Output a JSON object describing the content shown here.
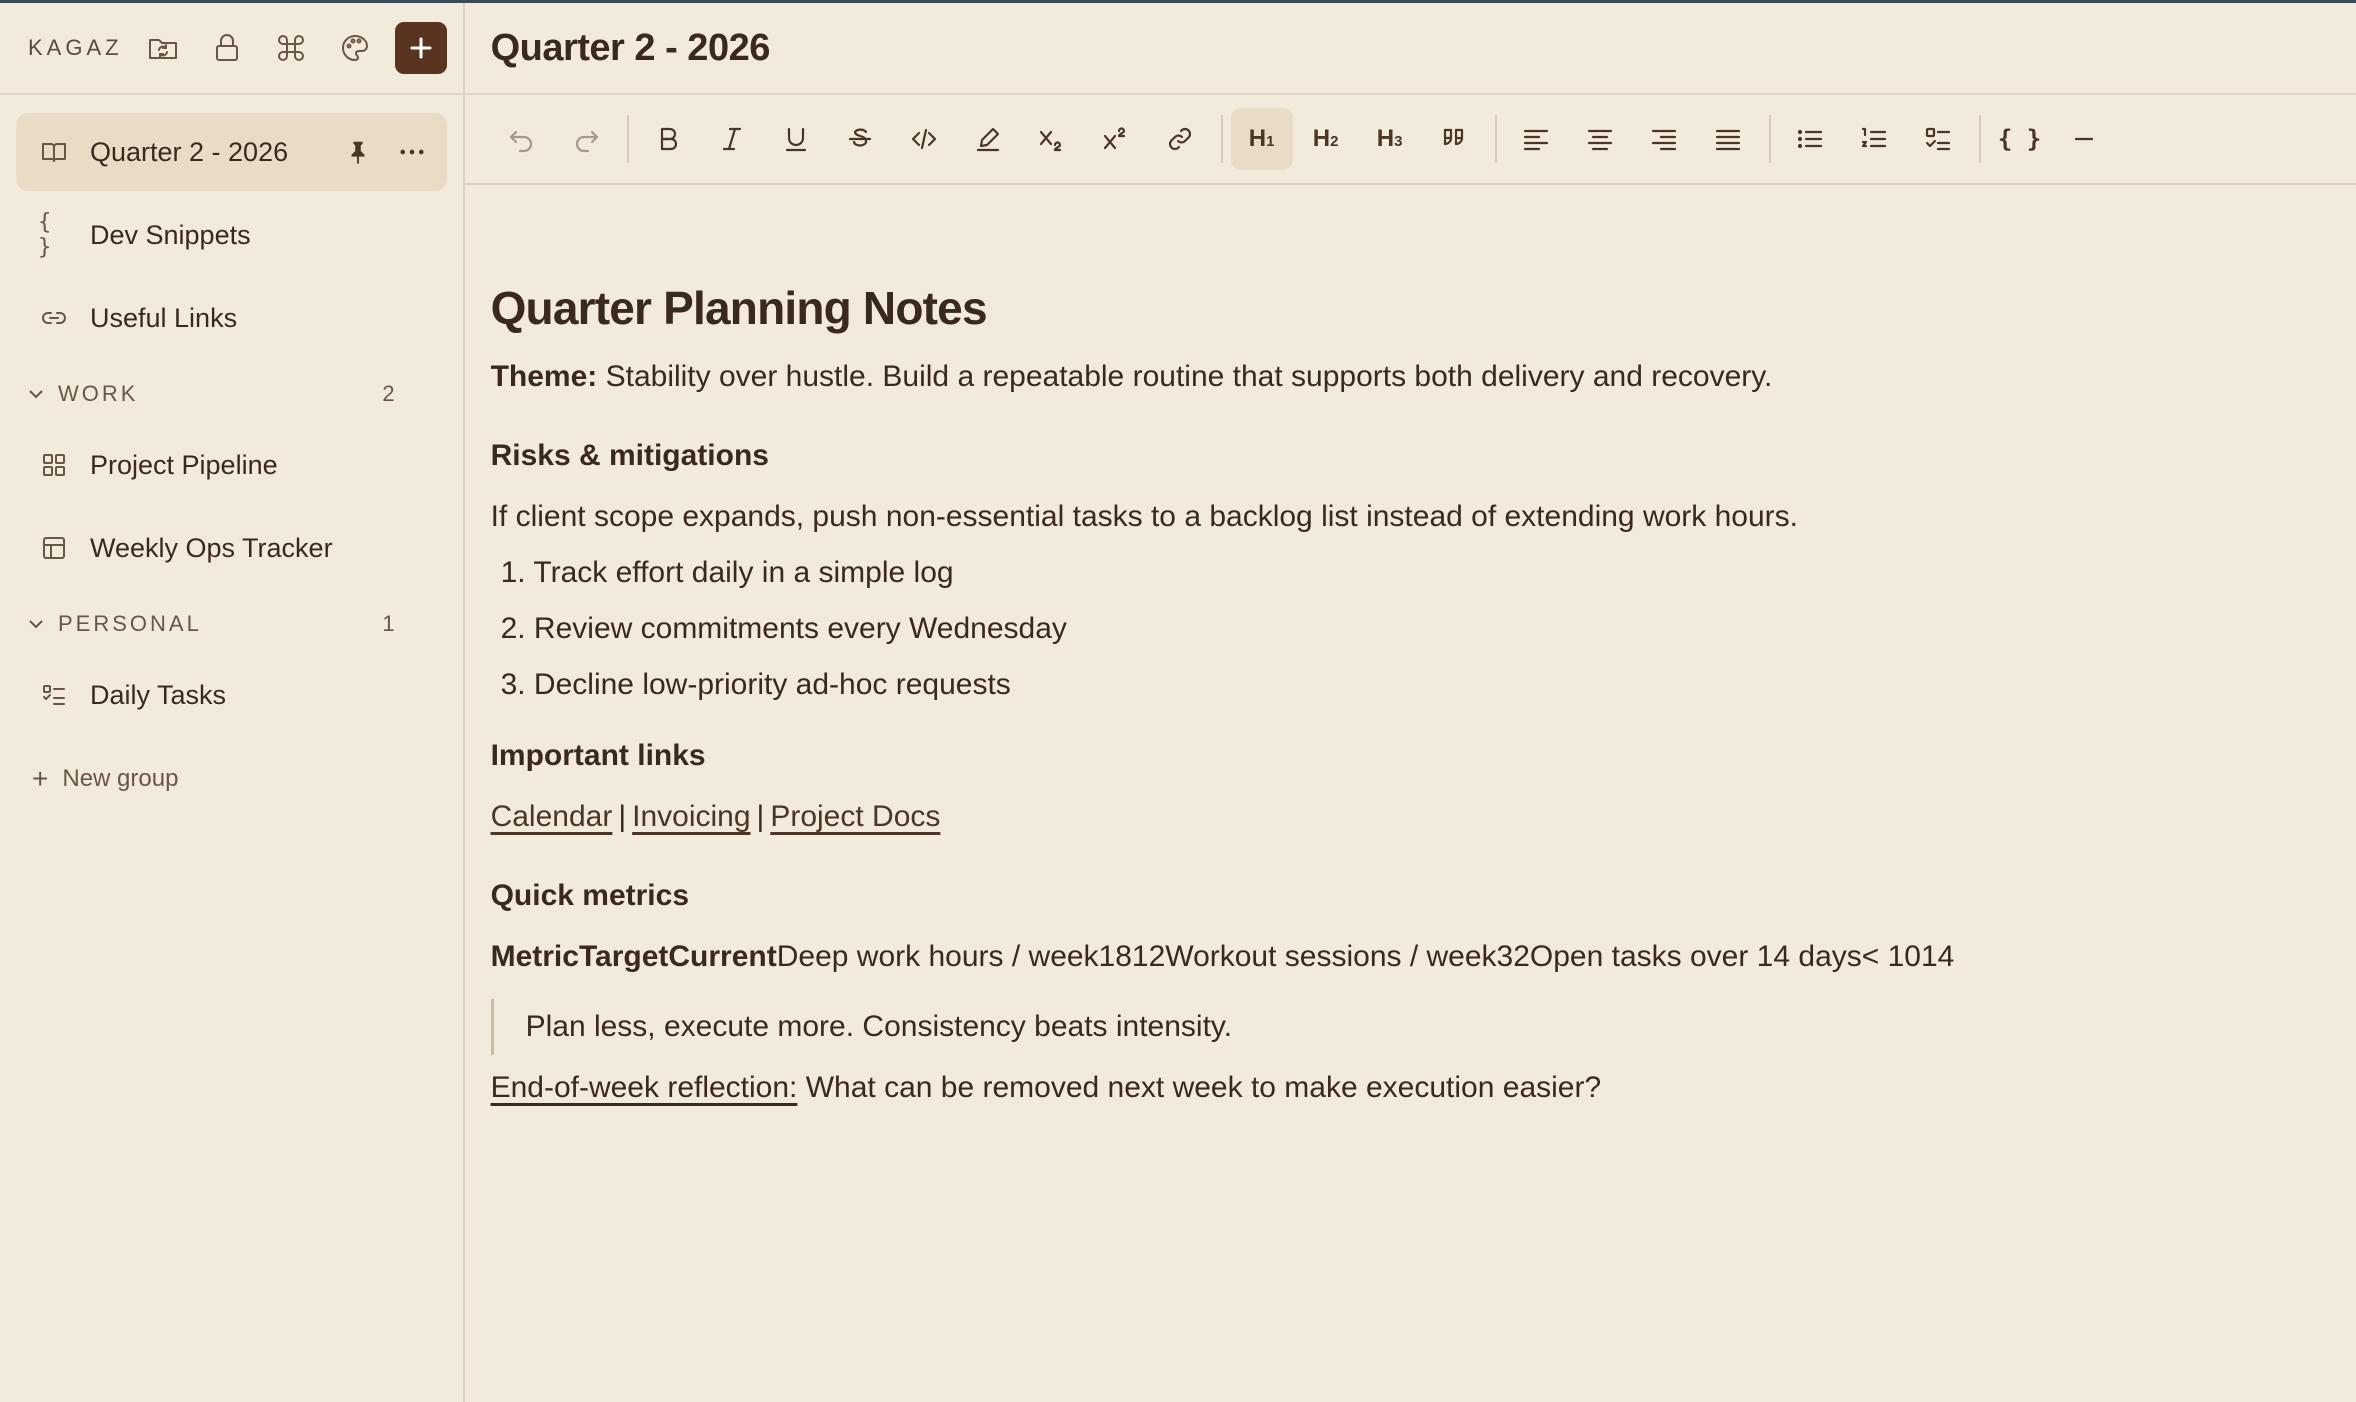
{
  "sidebar": {
    "brand": "KAGAZ",
    "header_icons": [
      "folder-sync-icon",
      "lock-icon",
      "command-icon",
      "palette-icon",
      "plus-icon"
    ],
    "pages": [
      {
        "label": "Quarter 2 - 2026",
        "icon": "book-open-icon",
        "active": true
      },
      {
        "label": "Dev Snippets",
        "icon": "braces-icon"
      },
      {
        "label": "Useful Links",
        "icon": "link-icon"
      }
    ],
    "groups": [
      {
        "name": "WORK",
        "count": "2",
        "items": [
          {
            "label": "Project Pipeline",
            "icon": "grid-icon"
          },
          {
            "label": "Weekly Ops Tracker",
            "icon": "table-icon"
          }
        ]
      },
      {
        "name": "PERSONAL",
        "count": "1",
        "items": [
          {
            "label": "Daily Tasks",
            "icon": "checklist-icon"
          }
        ]
      }
    ],
    "new_group": "New group",
    "braces_glyph": "{ }"
  },
  "document": {
    "title": "Quarter 2 - 2026",
    "toolbar": {
      "heading1": "H",
      "heading1_sub": "1",
      "heading2": "H",
      "heading2_sub": "2",
      "heading3": "H",
      "heading3_sub": "3",
      "codeblock": "{ }"
    },
    "heading": "Quarter Planning Notes",
    "theme_label": "Theme:",
    "theme_text": " Stability over hustle. Build a repeatable routine that supports both delivery and recovery.",
    "risks_heading": "Risks & mitigations",
    "risks_text": "If client scope expands, push non-essential tasks to a backlog list instead of extending work hours.",
    "risks_list": [
      "1. Track effort daily in a simple log",
      "2. Review commitments every Wednesday",
      "3. Decline low-priority ad-hoc requests"
    ],
    "links_heading": "Important links",
    "links": [
      "Calendar",
      "Invoicing",
      "Project Docs"
    ],
    "link_separator": "|",
    "metrics_heading": "Quick metrics",
    "metrics_headers": "MetricTargetCurrent",
    "metrics_rows": "Deep work hours / week1812Workout sessions / week32Open tasks over 14 days< 1014",
    "quote": "Plan less, execute more. Consistency beats intensity.",
    "reflection_label": "End-of-week reflection:",
    "reflection_text": " What can be removed next week to make execution easier?"
  },
  "colors": {
    "background": "#f2eadb",
    "active_item": "#e8dcc7",
    "accent": "#5a3420",
    "text": "#3a2a1e"
  }
}
